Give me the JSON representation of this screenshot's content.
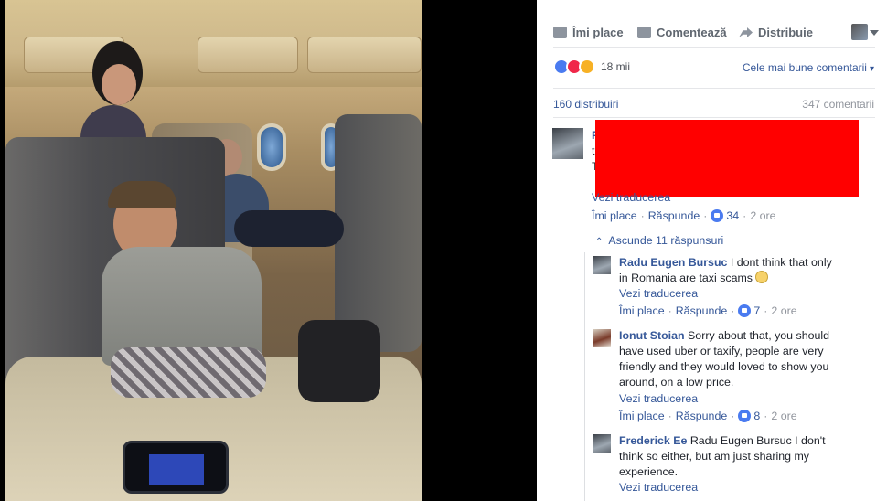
{
  "actions": {
    "like": "Îmi place",
    "comment": "Comentează",
    "share": "Distribuie"
  },
  "reactions": {
    "count": "18 mii",
    "sort_label": "Cele mai bune comentarii"
  },
  "stats": {
    "shares": "160 distribuiri",
    "comments": "347 comentarii"
  },
  "main_comment": {
    "name_initial": "F",
    "line2_initial": "t",
    "line3_initial": "T",
    "translate": "Vezi traducerea",
    "like": "Îmi place",
    "reply": "Răspunde",
    "likes": "34",
    "time": "2 ore"
  },
  "hide_replies": "Ascunde 11 răspunsuri",
  "replies": [
    {
      "name": "Radu Eugen Bursuc",
      "text_line1": " I dont think that only",
      "text_line2": "in Romania are taxi scams",
      "translate": "Vezi traducerea",
      "like": "Îmi place",
      "reply": "Răspunde",
      "likes": "7",
      "time": "2 ore"
    },
    {
      "name": "Ionut Stoian",
      "text_line1": " Sorry about that, you should",
      "text_line2": "have used uber or taxify, people are very",
      "text_line3": "friendly and they would loved to show you",
      "text_line4": "around, on a low price.",
      "translate": "Vezi traducerea",
      "like": "Îmi place",
      "reply": "Răspunde",
      "likes": "8",
      "time": "2 ore"
    },
    {
      "name": "Frederick Ee",
      "text_line1": " Radu Eugen Bursuc I don't",
      "text_line2": "think so either, but am just sharing my",
      "text_line3": "experience.",
      "translate": "Vezi traducerea"
    }
  ],
  "colors": {
    "link": "#365899",
    "redaction": "#ff0000",
    "like_blue": "#4a7bf0"
  }
}
